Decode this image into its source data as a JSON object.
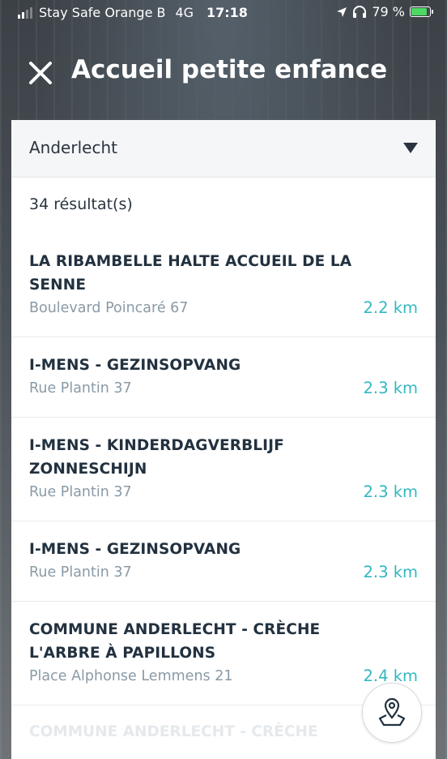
{
  "status_bar": {
    "carrier": "Stay Safe Orange B",
    "network": "4G",
    "time": "17:18",
    "battery": "79 %",
    "battery_level": 0.79
  },
  "header": {
    "title": "Accueil petite enfance",
    "close_icon": "close-icon"
  },
  "filter": {
    "selected": "Anderlecht",
    "caret_icon": "caret-down-icon"
  },
  "results": {
    "count_label": "34 résultat(s)",
    "items": [
      {
        "title_line1": "LA RIBAMBELLE HALTE ACCUEIL DE LA",
        "title_line2": "SENNE",
        "address": "Boulevard Poincaré 67",
        "distance": "2.2 km"
      },
      {
        "title_line1": "I-MENS - GEZINSOPVANG",
        "title_line2": "",
        "address": "Rue Plantin 37",
        "distance": "2.3 km"
      },
      {
        "title_line1": "I-MENS - KINDERDAGVERBLIJF",
        "title_line2": "ZONNESCHIJN",
        "address": "Rue Plantin 37",
        "distance": "2.3 km"
      },
      {
        "title_line1": "I-MENS - GEZINSOPVANG",
        "title_line2": "",
        "address": "Rue Plantin 37",
        "distance": "2.3 km"
      },
      {
        "title_line1": "COMMUNE ANDERLECHT - CRÈCHE",
        "title_line2": "L'ARBRE À PAPILLONS",
        "address": "Place Alphonse Lemmens 21",
        "distance": "2.4 km"
      }
    ],
    "partial_item_title": "COMMUNE ANDERLECHT - CRÈCHE"
  },
  "map_button": {
    "icon": "map-pin-icon"
  },
  "colors": {
    "accent": "#33b7c1",
    "title_text": "#22313f",
    "secondary_text": "#8a9aa6",
    "select_bg": "#f4f6f8"
  }
}
